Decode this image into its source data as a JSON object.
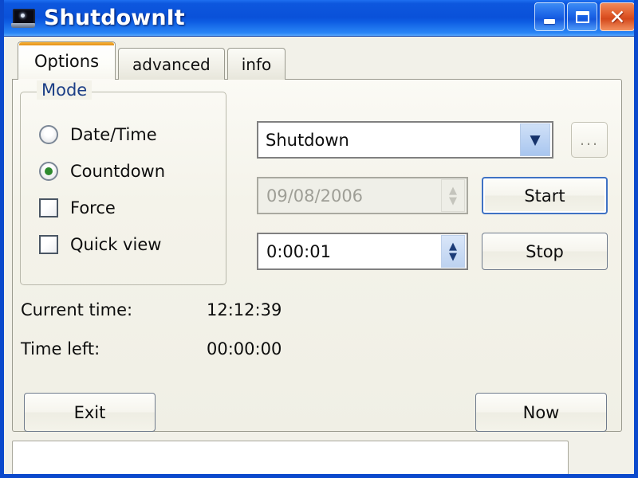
{
  "window": {
    "title": "ShutdownIt",
    "icon": "laptop-icon",
    "accent_blue": "#0b49cc",
    "titlebar_gradient_from": "#1e6ff0",
    "titlebar_gradient_to": "#5aa7fb",
    "face_color": "#f2f1e9",
    "caption_buttons": [
      {
        "name": "minimize-button",
        "glyph": "_"
      },
      {
        "name": "maximize-button",
        "glyph": "□"
      },
      {
        "name": "close-button",
        "glyph": "✕"
      }
    ]
  },
  "tabs": [
    {
      "label": "Options",
      "selected": true
    },
    {
      "label": "advanced",
      "selected": false
    },
    {
      "label": "info",
      "selected": false
    }
  ],
  "mode_group": {
    "legend": "Mode",
    "legend_color": "#1c3f86",
    "items": [
      {
        "type": "radio",
        "label": "Date/Time",
        "checked": false
      },
      {
        "type": "radio",
        "label": "Countdown",
        "checked": true
      },
      {
        "type": "checkbox",
        "label": "Force",
        "checked": false
      },
      {
        "type": "checkbox",
        "label": "Quick view",
        "checked": false
      }
    ],
    "radio_dot_color": "#2d8a2d"
  },
  "action_combo": {
    "value": "Shutdown",
    "arrow": "▼"
  },
  "browse_button": {
    "label": "..."
  },
  "date_field": {
    "value": "09/08/2006",
    "disabled": true,
    "spin_up": "▲",
    "spin_down": "▼"
  },
  "time_field": {
    "value": "0:00:01",
    "disabled": false,
    "spin_up": "▲",
    "spin_down": "▼"
  },
  "buttons": {
    "start": "Start",
    "stop": "Stop",
    "exit": "Exit",
    "now": "Now"
  },
  "status": {
    "current_time_label": "Current time:",
    "current_time_value": "12:12:39",
    "time_left_label": "Time left:",
    "time_left_value": "00:00:00"
  }
}
